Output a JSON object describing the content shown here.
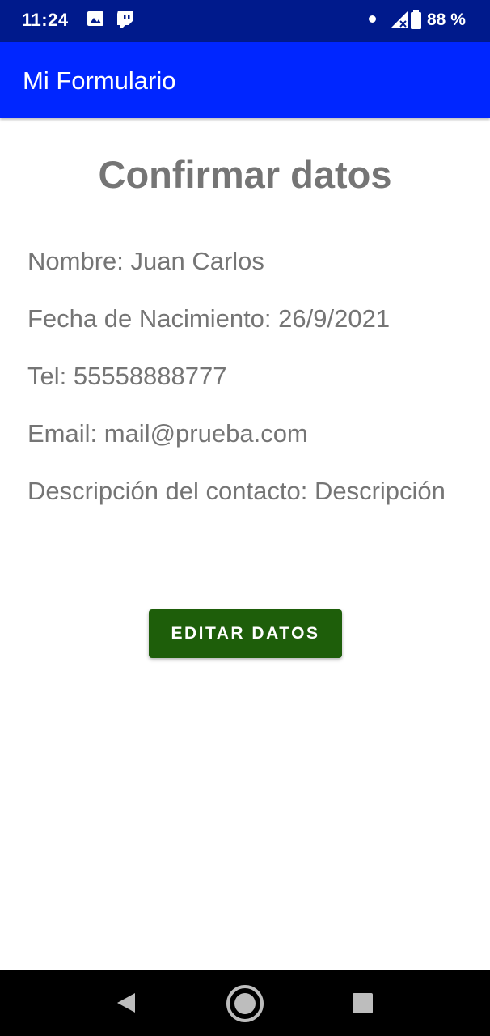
{
  "status_bar": {
    "time": "11:24",
    "battery_percent": "88 %",
    "icons": [
      "image-icon",
      "twitch-icon",
      "dot-icon",
      "signal-icon",
      "battery-icon"
    ]
  },
  "app_bar": {
    "title": "Mi Formulario"
  },
  "main": {
    "title": "Confirmar datos",
    "fields": {
      "name": "Nombre: Juan Carlos",
      "birth_date": "Fecha de Nacimiento: 26/9/2021",
      "tel": "Tel: 55558888777",
      "email": "Email: mail@prueba.com",
      "description": "Descripción del contacto: Descripción"
    },
    "edit_button_label": "EDITAR DATOS"
  },
  "nav_bar": {
    "icons": [
      "back-icon",
      "home-icon",
      "recents-icon"
    ]
  },
  "colors": {
    "status_bar": "#001a8c",
    "app_bar": "#0026ff",
    "text": "#757575",
    "button": "#1e5e0a",
    "nav_bar": "#000000"
  }
}
